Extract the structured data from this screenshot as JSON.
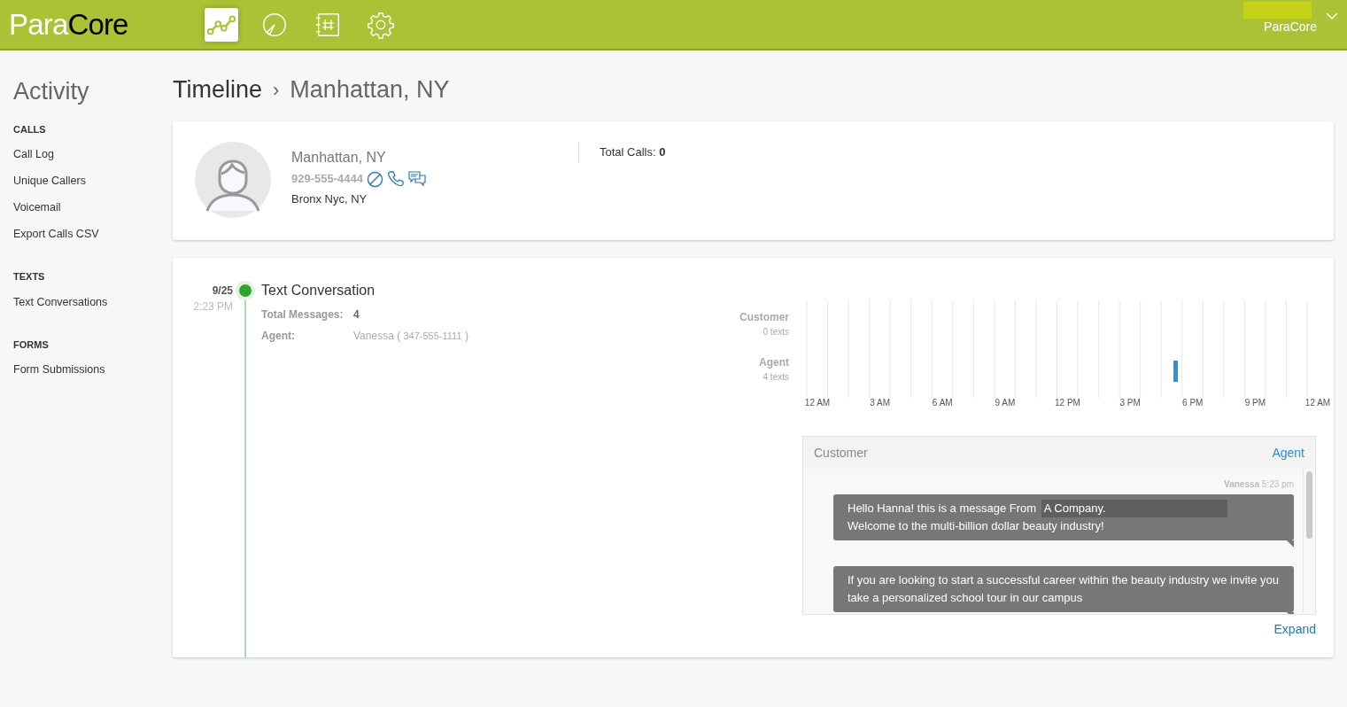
{
  "header": {
    "logo": {
      "light": "Para",
      "dark": "Core"
    },
    "nav": [
      {
        "kind": "trend",
        "selected": true
      },
      {
        "kind": "pie",
        "selected": false
      },
      {
        "kind": "notebook",
        "selected": false
      },
      {
        "kind": "gear",
        "selected": false
      }
    ],
    "account": {
      "name": "ParaCore"
    }
  },
  "sidebar": {
    "title": "Activity",
    "sections": [
      {
        "heading": "CALLS",
        "items": [
          "Call Log",
          "Unique Callers",
          "Voicemail",
          "Export Calls CSV"
        ]
      },
      {
        "heading": "TEXTS",
        "items": [
          "Text Conversations"
        ]
      },
      {
        "heading": "FORMS",
        "items": [
          "Form Submissions"
        ]
      }
    ]
  },
  "breadcrumb": {
    "parent": "Timeline",
    "separator": "›",
    "current": "Manhattan, NY"
  },
  "contact": {
    "name": "Manhattan, NY",
    "phone": "929-555-4444",
    "location": "Bronx Nyc, NY",
    "total_calls_label": "Total Calls:",
    "total_calls": "0"
  },
  "event": {
    "date": "9/25",
    "time": "2:23 PM",
    "title": "Text Conversation",
    "total_label": "Total Messages:",
    "total": "4",
    "agent_label": "Agent:",
    "agent_name": "Vanessa (",
    "agent_phone": "347-555-1111",
    "agent_close": ")",
    "activity": {
      "rows": [
        {
          "name": "Customer",
          "count": "0 texts"
        },
        {
          "name": "Agent",
          "count": "4 texts"
        }
      ],
      "time_labels": [
        "12 AM",
        "3 AM",
        "6 AM",
        "9 AM",
        "12 PM",
        "3 PM",
        "6 PM",
        "9 PM",
        "12 AM"
      ]
    },
    "chat": {
      "tabs": [
        {
          "label": "Customer",
          "selected": false
        },
        {
          "label": "Agent",
          "selected": true
        }
      ],
      "meta_name": "Vanessa",
      "meta_time": "5:23 pm",
      "messages": [
        [
          {
            "text": "Hello Hanna! this is a message From",
            "highlight": false
          },
          {
            "text": "A Company.",
            "highlight": true
          },
          {
            "text": "Welcome to the multi-billion dollar beauty industry!",
            "highlight": false
          }
        ],
        [
          {
            "text": "If you are looking to start a successful career within the beauty industry we invite you take a personalized school tour in our campus",
            "highlight": false
          }
        ]
      ],
      "expand": "Expand"
    }
  }
}
